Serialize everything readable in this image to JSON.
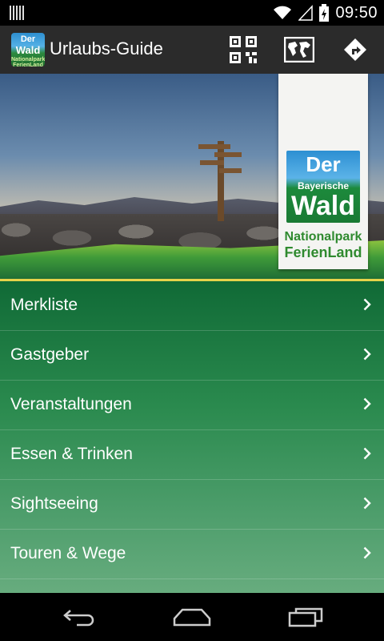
{
  "status_bar": {
    "time": "09:50"
  },
  "action_bar": {
    "title": "Urlaubs-Guide",
    "app_icon_text": [
      "Der",
      "Wald",
      "Nationalpark FerienLand"
    ],
    "actions": [
      "qr-code-icon",
      "map-icon",
      "directions-icon"
    ]
  },
  "hero": {
    "logo": {
      "line1": "Der",
      "line2": "Bayerische",
      "line3": "Wald",
      "line4": "Nationalpark",
      "line5": "FerienLand"
    }
  },
  "menu": {
    "items": [
      {
        "label": "Merkliste"
      },
      {
        "label": "Gastgeber"
      },
      {
        "label": "Veranstaltungen"
      },
      {
        "label": "Essen & Trinken"
      },
      {
        "label": "Sightseeing"
      },
      {
        "label": "Touren & Wege"
      }
    ]
  },
  "nav_bar": {
    "buttons": [
      "back-icon",
      "home-icon",
      "recents-icon"
    ]
  },
  "colors": {
    "menu_top": "#106a36",
    "menu_bottom": "#67ac7e",
    "accent_line": "#e5d34a",
    "action_bar": "#2b2b2b"
  }
}
